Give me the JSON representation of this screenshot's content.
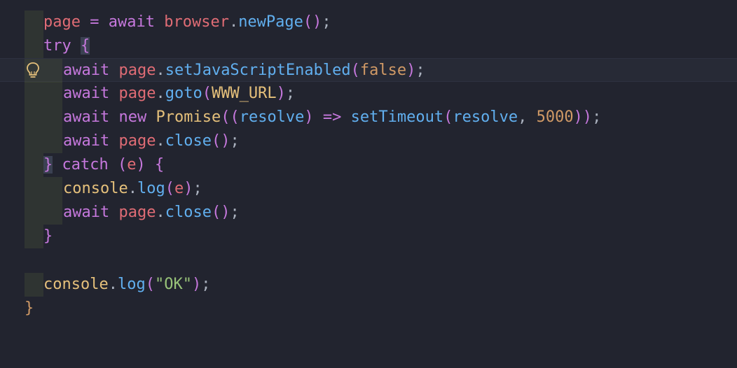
{
  "colors": {
    "background": "#22242f",
    "keyword": "#c678dd",
    "variable": "#e06c75",
    "function": "#61afef",
    "class": "#e5c07b",
    "string": "#98c379",
    "number": "#d19a66",
    "punct": "#abb2bf",
    "bracket": "#c678dd",
    "arrow": "#c678dd",
    "param": "#61afef"
  },
  "icons": {
    "lightbulb": "lightbulb-icon"
  },
  "lines": [
    {
      "id": "l1",
      "tokens": [
        {
          "t": "page",
          "c": "variable"
        },
        {
          "t": " = ",
          "c": "keyword"
        },
        {
          "t": "await",
          "c": "keyword"
        },
        {
          "t": " ",
          "c": "punct"
        },
        {
          "t": "browser",
          "c": "variable"
        },
        {
          "t": ".",
          "c": "punct"
        },
        {
          "t": "newPage",
          "c": "function"
        },
        {
          "t": "()",
          "c": "bracket"
        },
        {
          "t": ";",
          "c": "punct"
        }
      ]
    },
    {
      "id": "l2",
      "tokens": [
        {
          "t": "try",
          "c": "keyword"
        },
        {
          "t": " ",
          "c": "punct"
        },
        {
          "t": "{",
          "c": "bracket"
        }
      ]
    },
    {
      "id": "l3",
      "tokens": [
        {
          "t": "await",
          "c": "keyword"
        },
        {
          "t": " ",
          "c": "punct"
        },
        {
          "t": "page",
          "c": "variable"
        },
        {
          "t": ".",
          "c": "punct"
        },
        {
          "t": "setJavaScriptEnabled",
          "c": "function"
        },
        {
          "t": "(",
          "c": "bracket"
        },
        {
          "t": "false",
          "c": "number"
        },
        {
          "t": ")",
          "c": "bracket"
        },
        {
          "t": ";",
          "c": "punct"
        }
      ]
    },
    {
      "id": "l4",
      "tokens": [
        {
          "t": "await",
          "c": "keyword"
        },
        {
          "t": " ",
          "c": "punct"
        },
        {
          "t": "page",
          "c": "variable"
        },
        {
          "t": ".",
          "c": "punct"
        },
        {
          "t": "goto",
          "c": "function"
        },
        {
          "t": "(",
          "c": "bracket"
        },
        {
          "t": "WWW_URL",
          "c": "class"
        },
        {
          "t": ")",
          "c": "bracket"
        },
        {
          "t": ";",
          "c": "punct"
        }
      ]
    },
    {
      "id": "l5",
      "tokens": [
        {
          "t": "await",
          "c": "keyword"
        },
        {
          "t": " ",
          "c": "punct"
        },
        {
          "t": "new",
          "c": "keyword"
        },
        {
          "t": " ",
          "c": "punct"
        },
        {
          "t": "Promise",
          "c": "class"
        },
        {
          "t": "((",
          "c": "bracket"
        },
        {
          "t": "resolve",
          "c": "param"
        },
        {
          "t": ")",
          "c": "bracket"
        },
        {
          "t": " => ",
          "c": "arrow"
        },
        {
          "t": "setTimeout",
          "c": "function"
        },
        {
          "t": "(",
          "c": "bracket"
        },
        {
          "t": "resolve",
          "c": "param"
        },
        {
          "t": ", ",
          "c": "punct"
        },
        {
          "t": "5000",
          "c": "number"
        },
        {
          "t": "))",
          "c": "bracket"
        },
        {
          "t": ";",
          "c": "punct"
        }
      ]
    },
    {
      "id": "l6",
      "tokens": [
        {
          "t": "await",
          "c": "keyword"
        },
        {
          "t": " ",
          "c": "punct"
        },
        {
          "t": "page",
          "c": "variable"
        },
        {
          "t": ".",
          "c": "punct"
        },
        {
          "t": "close",
          "c": "function"
        },
        {
          "t": "()",
          "c": "bracket"
        },
        {
          "t": ";",
          "c": "punct"
        }
      ]
    },
    {
      "id": "l7",
      "tokens": [
        {
          "t": "}",
          "c": "bracket"
        },
        {
          "t": " ",
          "c": "punct"
        },
        {
          "t": "catch",
          "c": "keyword"
        },
        {
          "t": " ",
          "c": "punct"
        },
        {
          "t": "(",
          "c": "bracket"
        },
        {
          "t": "e",
          "c": "variable"
        },
        {
          "t": ")",
          "c": "bracket"
        },
        {
          "t": " ",
          "c": "punct"
        },
        {
          "t": "{",
          "c": "bracket"
        }
      ]
    },
    {
      "id": "l8",
      "tokens": [
        {
          "t": "console",
          "c": "class"
        },
        {
          "t": ".",
          "c": "punct"
        },
        {
          "t": "log",
          "c": "function"
        },
        {
          "t": "(",
          "c": "bracket"
        },
        {
          "t": "e",
          "c": "variable"
        },
        {
          "t": ")",
          "c": "bracket"
        },
        {
          "t": ";",
          "c": "punct"
        }
      ]
    },
    {
      "id": "l9",
      "tokens": [
        {
          "t": "await",
          "c": "keyword"
        },
        {
          "t": " ",
          "c": "punct"
        },
        {
          "t": "page",
          "c": "variable"
        },
        {
          "t": ".",
          "c": "punct"
        },
        {
          "t": "close",
          "c": "function"
        },
        {
          "t": "()",
          "c": "bracket"
        },
        {
          "t": ";",
          "c": "punct"
        }
      ]
    },
    {
      "id": "l10",
      "tokens": [
        {
          "t": "}",
          "c": "bracket"
        }
      ]
    },
    {
      "id": "l11",
      "tokens": []
    },
    {
      "id": "l12",
      "tokens": [
        {
          "t": "console",
          "c": "class"
        },
        {
          "t": ".",
          "c": "punct"
        },
        {
          "t": "log",
          "c": "function"
        },
        {
          "t": "(",
          "c": "bracket"
        },
        {
          "t": "\"OK\"",
          "c": "string"
        },
        {
          "t": ")",
          "c": "bracket"
        },
        {
          "t": ";",
          "c": "punct"
        }
      ]
    },
    {
      "id": "l13",
      "tokens": [
        {
          "t": "}",
          "c": "number"
        }
      ]
    }
  ]
}
